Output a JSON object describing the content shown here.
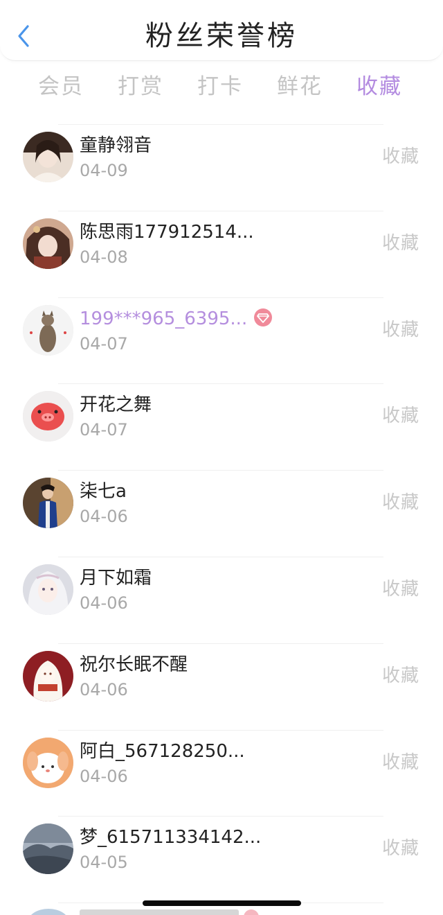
{
  "header": {
    "title": "粉丝荣誉榜",
    "accent_color": "#4a95ea"
  },
  "tabs": [
    {
      "label": "会员"
    },
    {
      "label": "打赏"
    },
    {
      "label": "打卡"
    },
    {
      "label": "鲜花"
    },
    {
      "label": "收藏",
      "active": true
    }
  ],
  "active_color": "#b38be0",
  "list": [
    {
      "name": "童静翎音",
      "date": "04-09",
      "action": "收藏"
    },
    {
      "name": "陈思雨177912514...",
      "date": "04-08",
      "action": "收藏"
    },
    {
      "name": "199***965_6395...",
      "date": "04-07",
      "action": "收藏",
      "vip": true,
      "badge_icon": "diamond-icon"
    },
    {
      "name": "开花之舞",
      "date": "04-07",
      "action": "收藏"
    },
    {
      "name": "柒七a",
      "date": "04-06",
      "action": "收藏"
    },
    {
      "name": "月下如霜",
      "date": "04-06",
      "action": "收藏"
    },
    {
      "name": "祝尔长眠不醒",
      "date": "04-06",
      "action": "收藏"
    },
    {
      "name": "阿白_567128250...",
      "date": "04-06",
      "action": "收藏"
    },
    {
      "name": "梦_615711334142...",
      "date": "04-05",
      "action": "收藏"
    }
  ]
}
